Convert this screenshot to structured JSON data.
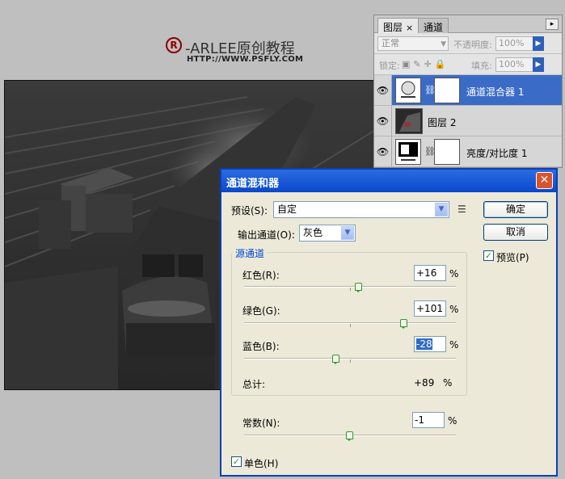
{
  "watermark": {
    "title": "-ARLEE原创教程",
    "url": "HTTP://WWW.PSFLY.COM",
    "r_symbol": "R"
  },
  "layers_panel": {
    "tabs": [
      "图层",
      "通道"
    ],
    "tab_close": "×",
    "menu_icon": "▸",
    "blend_mode": "正常",
    "opacity_label": "不透明度:",
    "opacity_value": "100%",
    "lock_label": "锁定:",
    "fill_label": "填充:",
    "fill_value": "100%",
    "layers": [
      {
        "name": "通道混合器 1",
        "selected": true
      },
      {
        "name": "图层 2",
        "selected": false
      },
      {
        "name": "亮度/对比度 1",
        "selected": false
      }
    ]
  },
  "dialog": {
    "title": "通道混和器",
    "close": "✕",
    "preset_label": "预设(S):",
    "preset_value": "自定",
    "output_label": "输出通道(O):",
    "output_value": "灰色",
    "ok_label": "确定",
    "cancel_label": "取消",
    "preview_label": "预览(P)",
    "preview_checked": true,
    "source_group_title": "源通道",
    "channels": [
      {
        "label": "红色(R):",
        "value": "+16",
        "unit": "%",
        "slider": 16
      },
      {
        "label": "绿色(G):",
        "value": "+101",
        "unit": "%",
        "slider": 101
      },
      {
        "label": "蓝色(B):",
        "value": "-28",
        "unit": "%",
        "slider": -28
      }
    ],
    "total_label": "总计:",
    "total_value": "+89",
    "total_unit": "%",
    "constant_label": "常数(N):",
    "constant_value": "-1",
    "constant_unit": "%",
    "constant_slider": -1,
    "mono_label": "单色(H)",
    "mono_checked": true
  }
}
